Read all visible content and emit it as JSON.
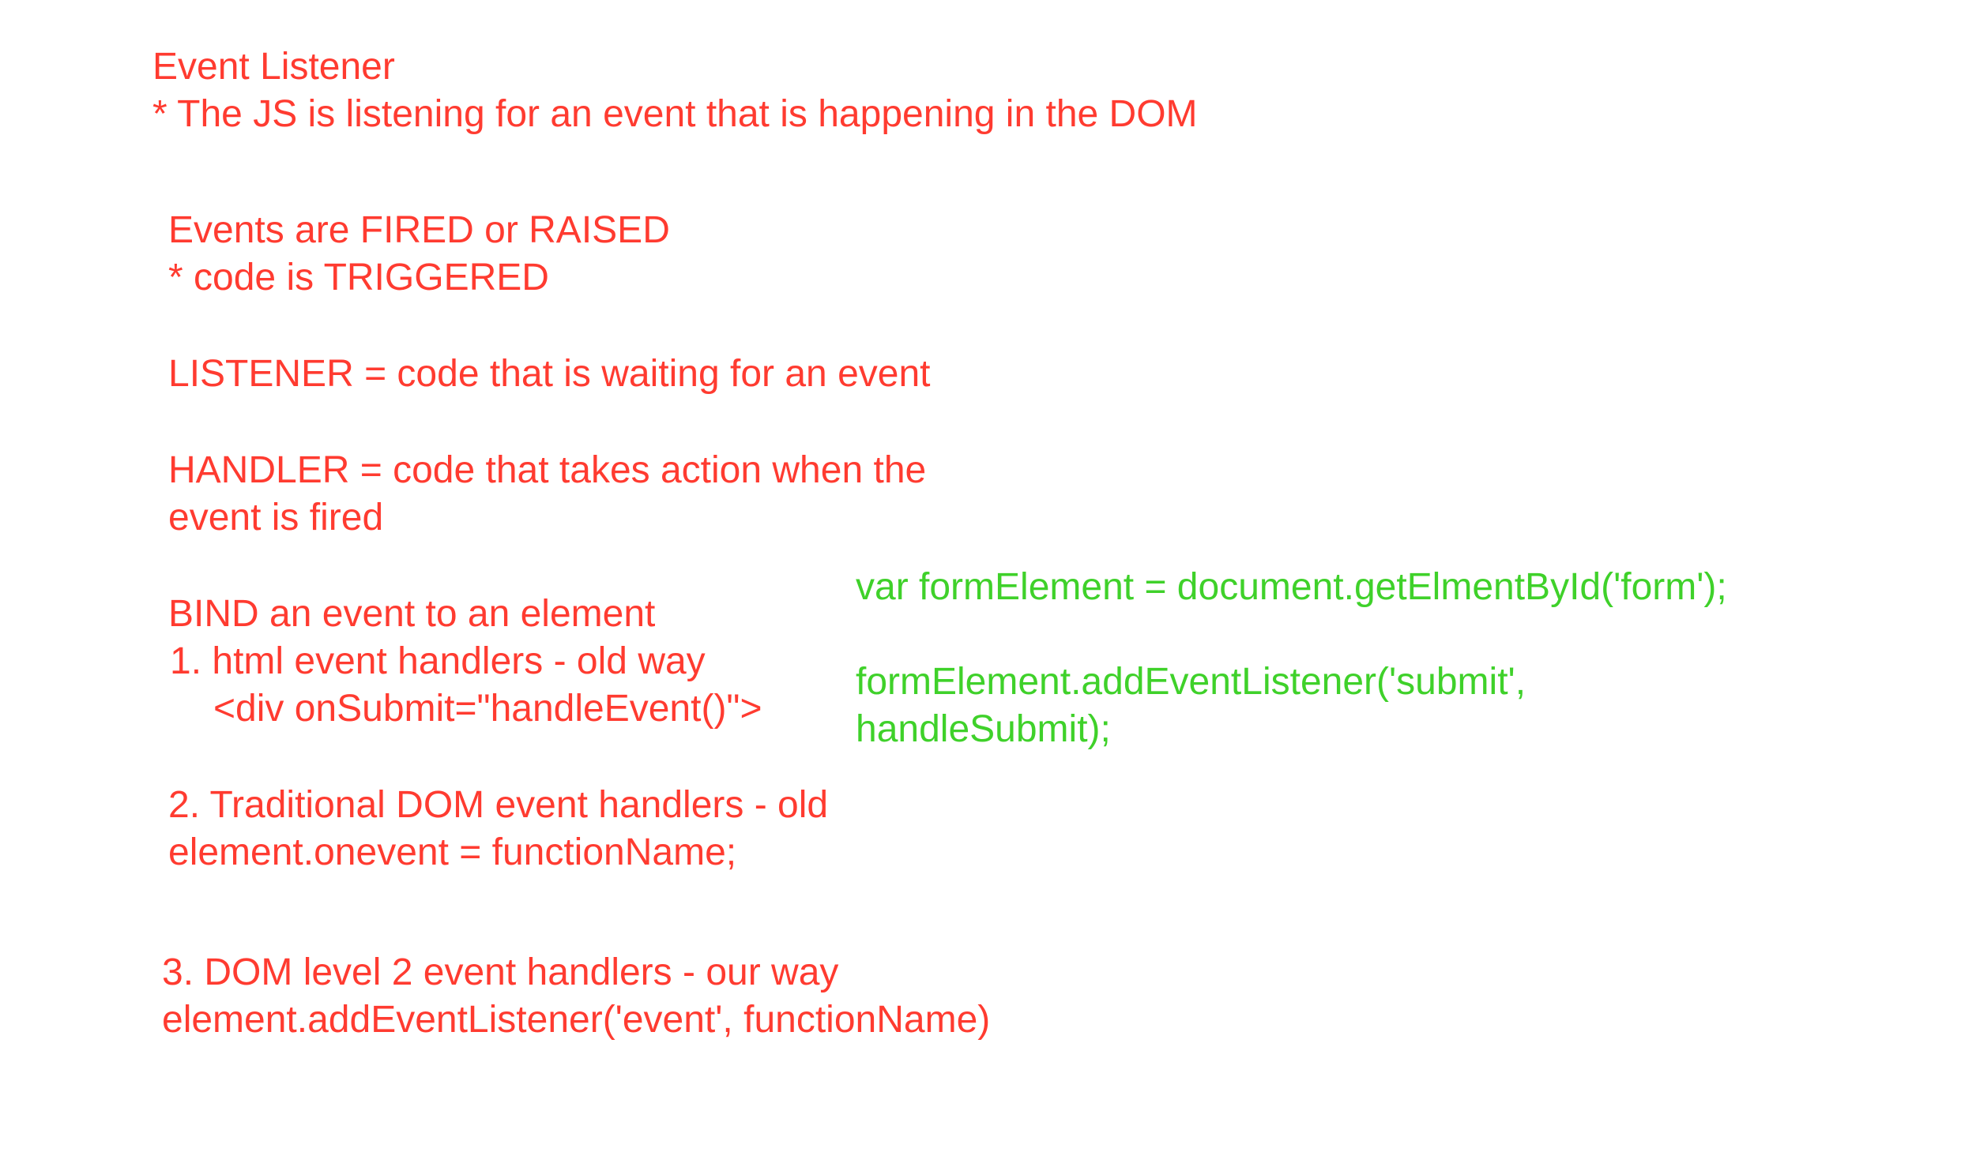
{
  "notes": {
    "title": "Event Listener",
    "title_note": "* The JS is listening for an event that is happening in the DOM",
    "fired_heading": "Events are FIRED or RAISED",
    "fired_note": "* code is TRIGGERED",
    "listener_def": "LISTENER = code that is waiting for an event",
    "handler_def_line1": "HANDLER = code that takes action when the",
    "handler_def_line2": "event is fired",
    "bind_heading": "BIND an event to an element",
    "method1_heading": "1. html event handlers - old way",
    "method1_code": "<div onSubmit=\"handleEvent()\">",
    "method2_heading": "2. Traditional DOM event handlers - old",
    "method2_code": "element.onevent = functionName;",
    "method3_heading": "3. DOM level 2 event handlers - our way",
    "method3_code": "element.addEventListener('event', functionName)"
  },
  "code_example": {
    "line1": "var formElement = document.getElmentById('form');",
    "line2": "formElement.addEventListener('submit',",
    "line3": "handleSubmit);"
  },
  "colors": {
    "notes_text": "#ff3b30",
    "code_text": "#3fd12a"
  }
}
